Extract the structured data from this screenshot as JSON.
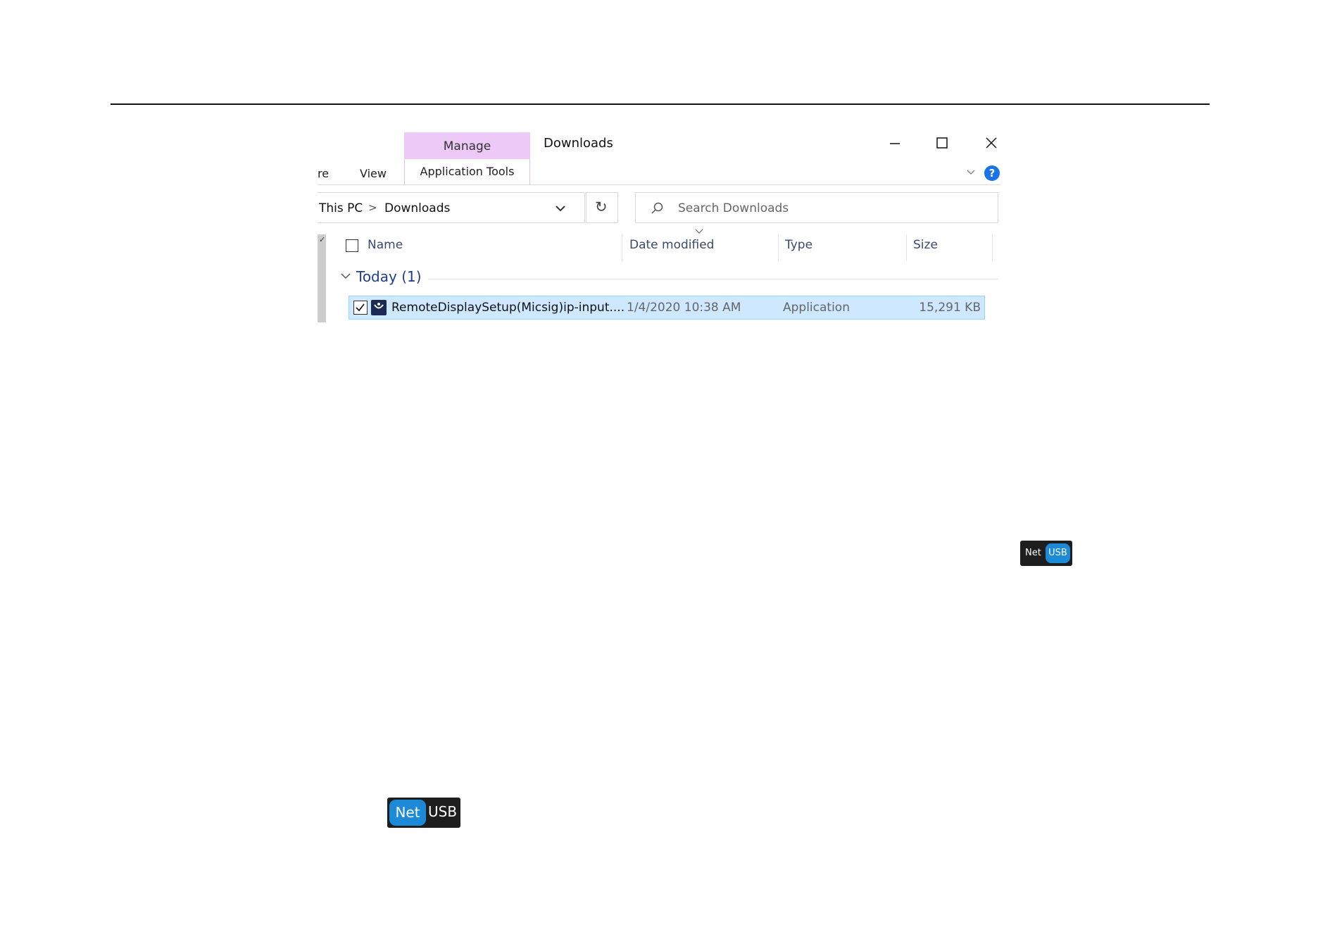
{
  "explorer": {
    "contextual_tab": "Manage",
    "contextual_subtab": "Application Tools",
    "window_title": "Downloads",
    "ribbon_tabs": [
      "re",
      "View"
    ],
    "breadcrumb": [
      "This PC",
      "Downloads"
    ],
    "breadcrumb_separator": ">",
    "search_placeholder": "Search Downloads",
    "columns": [
      "Name",
      "Date modified",
      "Type",
      "Size"
    ],
    "group_label": "Today (1)",
    "file": {
      "name": "RemoteDisplaySetup(Micsig)ip-input....",
      "date_modified": "1/4/2020 10:38 AM",
      "type": "Application",
      "size": "15,291 KB",
      "selected": true
    },
    "help_label": "?",
    "refresh_glyph": "↻"
  },
  "toggle_small": {
    "left": "Net",
    "right": "USB",
    "active": "USB"
  },
  "toggle_large": {
    "left": "Net",
    "right": "USB",
    "active": "Net"
  },
  "colors": {
    "contextual_tab": "#ecc9f6",
    "selection": "#cde8ff",
    "group_label": "#1e3d8f",
    "toggle_active": "#1c8ad6",
    "toggle_bg": "#1e1e1e"
  }
}
